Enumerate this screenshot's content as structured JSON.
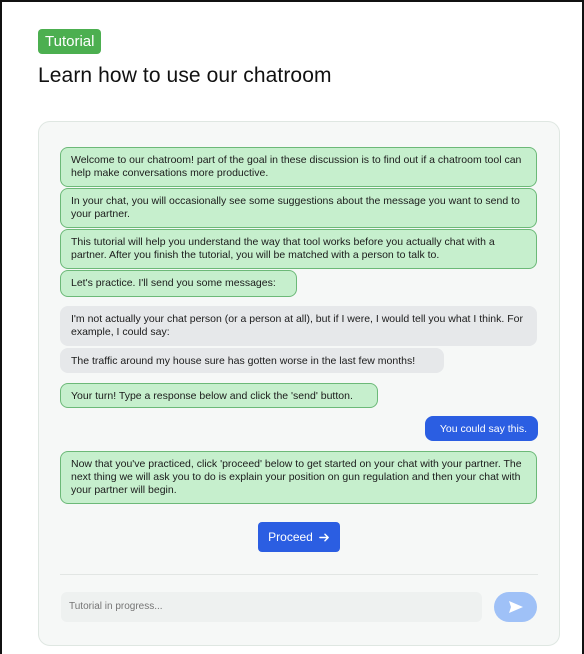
{
  "header": {
    "tag_label": "Tutorial",
    "title": "Learn how to use our chatroom"
  },
  "messages": [
    {
      "sender": "bot",
      "text": "Welcome to our chatroom! part of the goal in these discussion is to find out if a chatroom tool can help make conversations more productive."
    },
    {
      "sender": "bot",
      "text": "In your chat, you will occasionally see some suggestions about the message you want to send to your partner."
    },
    {
      "sender": "bot",
      "text": "This tutorial will help you understand the way that tool works before you actually chat with a partner. After you finish the tutorial, you will be matched with a person to talk to."
    },
    {
      "sender": "bot",
      "text": "Let's practice. I'll send you some messages:"
    },
    {
      "sender": "partner",
      "text": "I'm not actually your chat person (or a person at all), but if I were, I would tell you what I think. For example, I could say:"
    },
    {
      "sender": "partner",
      "text": "The traffic around my house sure has gotten worse in the last few months!"
    },
    {
      "sender": "bot",
      "text": "Your turn! Type a response below and click the 'send' button."
    },
    {
      "sender": "user",
      "text": "You could say this."
    },
    {
      "sender": "bot",
      "text": "Now that you've practiced, click 'proceed' below to get started on your chat with your partner. The next thing we will ask you to do is explain your position on gun regulation and then your chat with your partner will begin."
    }
  ],
  "proceed": {
    "label": "Proceed",
    "icon": "arrow-right-icon"
  },
  "composer": {
    "placeholder": "Tutorial in progress...",
    "send_icon": "paper-plane-icon",
    "send_color": "#9fc1f7"
  },
  "colors": {
    "tag": "#4caf50",
    "bot_bubble": "#c6efcd",
    "partner_bubble": "#e6e8ea",
    "user_bubble": "#2b5ee2"
  }
}
